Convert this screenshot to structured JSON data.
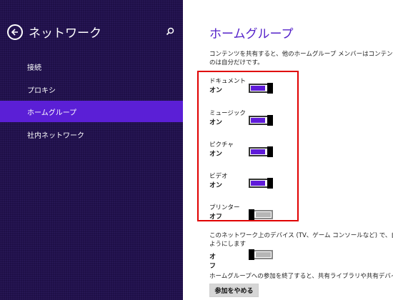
{
  "nav": {
    "title": "ネットワーク",
    "items": [
      {
        "label": "接続"
      },
      {
        "label": "プロキシ"
      },
      {
        "label": "ホームグループ"
      },
      {
        "label": "社内ネットワーク"
      }
    ],
    "selected_index": 2
  },
  "main": {
    "title": "ホームグループ",
    "description_lines": [
      "コンテンツを共有すると、他のホームグループ メンバーはコンテンツを参照",
      "のは自分だけです。"
    ],
    "libraries": [
      {
        "label": "ドキュメント",
        "state": "オン",
        "on": true
      },
      {
        "label": "ミュージック",
        "state": "オン",
        "on": true
      },
      {
        "label": "ピクチャ",
        "state": "オン",
        "on": true
      },
      {
        "label": "ビデオ",
        "state": "オン",
        "on": true
      },
      {
        "label": "プリンター",
        "state": "オフ",
        "on": false
      }
    ],
    "devices_lines": [
      "このネットワーク上のデバイス (TV、ゲーム コンソールなど) で、自分の音",
      "ようにします"
    ],
    "devices_state": "オフ",
    "devices_on": false,
    "leave_text": "ホームグループへの参加を終了すると、共有ライブラリや共有デバイスに",
    "leave_button": "参加をやめる"
  },
  "colors": {
    "nav_background": "#1e0f47",
    "nav_selected": "#5b1fd6",
    "accent": "#5421c9",
    "toggle_on": "#5f1bd9",
    "highlight_box": "#e00000"
  }
}
